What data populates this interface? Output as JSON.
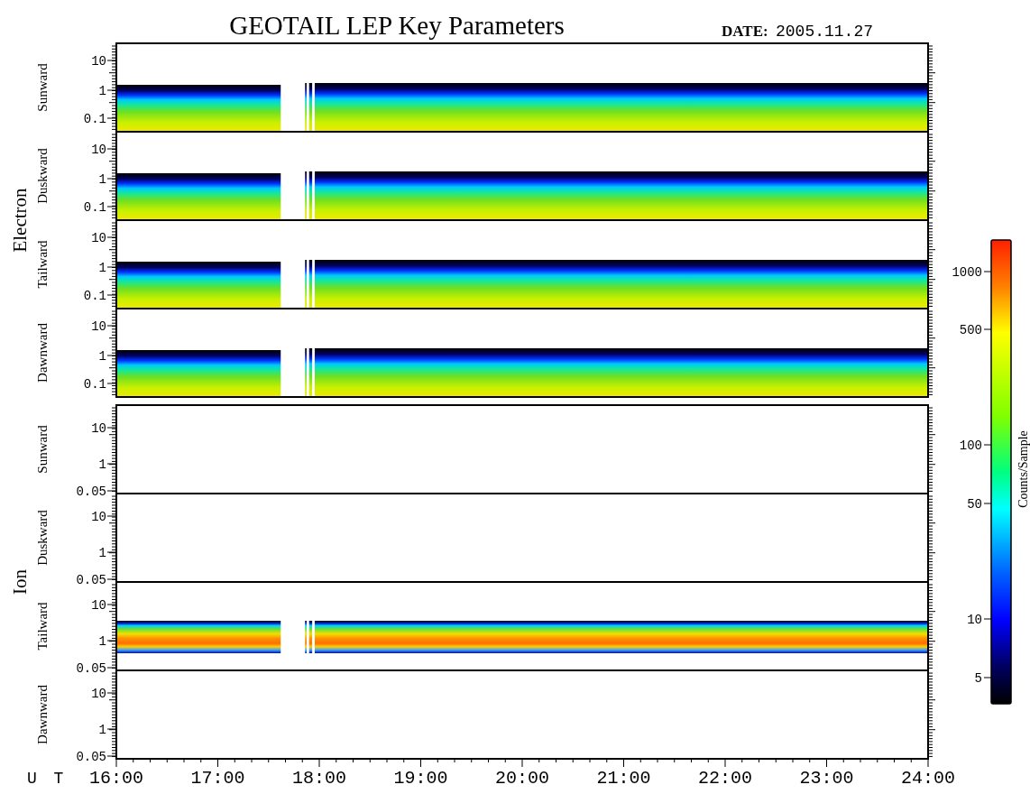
{
  "title": "GEOTAIL LEP Key Parameters",
  "date_label": "DATE:",
  "date": "2005.11.27",
  "groups": [
    {
      "species": "Electron",
      "panels": [
        {
          "direction": "Sunward",
          "kind": "electron",
          "y_ticks": [
            "10",
            "1",
            "0.1"
          ]
        },
        {
          "direction": "Duskward",
          "kind": "electron",
          "y_ticks": [
            "10",
            "1",
            "0.1"
          ]
        },
        {
          "direction": "Tailward",
          "kind": "electron",
          "y_ticks": [
            "10",
            "1",
            "0.1"
          ]
        },
        {
          "direction": "Dawnward",
          "kind": "electron",
          "y_ticks": [
            "10",
            "1",
            "0.1"
          ]
        }
      ]
    },
    {
      "species": "Ion",
      "panels": [
        {
          "direction": "Sunward",
          "kind": "empty",
          "y_ticks": [
            "10",
            "1",
            "0.05"
          ]
        },
        {
          "direction": "Duskward",
          "kind": "empty",
          "y_ticks": [
            "10",
            "1",
            "0.05"
          ]
        },
        {
          "direction": "Tailward",
          "kind": "ion",
          "y_ticks": [
            "10",
            "1",
            "0.05"
          ]
        },
        {
          "direction": "Dawnward",
          "kind": "empty",
          "y_ticks": [
            "10",
            "1",
            "0.05"
          ]
        }
      ]
    }
  ],
  "x_axis": {
    "label": "U T",
    "ticks": [
      "16:00",
      "17:00",
      "18:00",
      "19:00",
      "20:00",
      "21:00",
      "22:00",
      "23:00",
      "24:00"
    ]
  },
  "colorbar": {
    "label": "Counts/Sample",
    "ticks": [
      "1000",
      "500",
      "100",
      "50",
      "10",
      "5"
    ]
  }
}
